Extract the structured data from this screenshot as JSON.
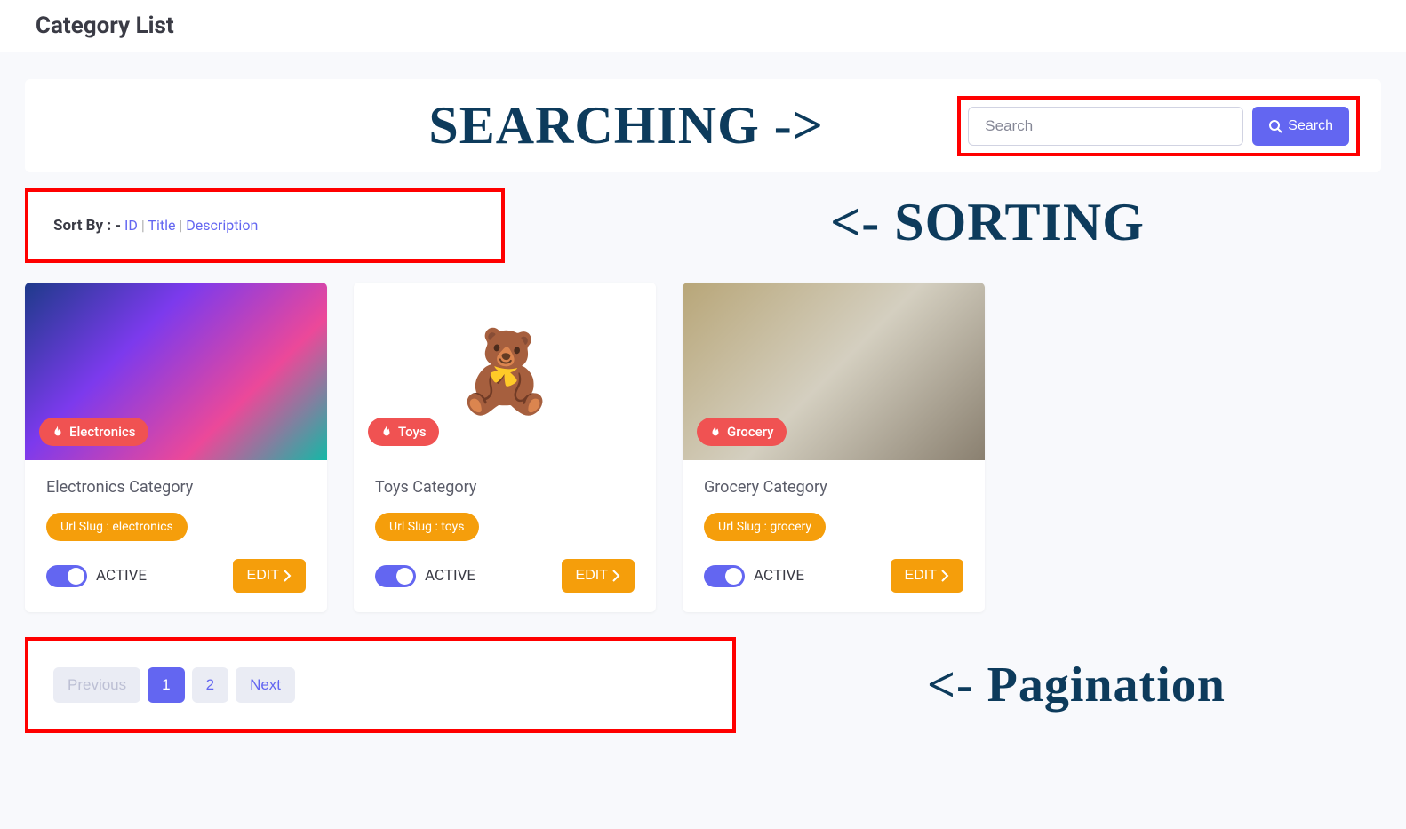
{
  "page": {
    "title": "Category List"
  },
  "annotations": {
    "searching": "SEARCHING ->",
    "sorting": "<- SORTING",
    "pagination": "<- Pagination"
  },
  "search": {
    "placeholder": "Search",
    "button_label": "Search"
  },
  "sort": {
    "label": "Sort By : -",
    "options": [
      "ID",
      "Title",
      "Description"
    ]
  },
  "cards": [
    {
      "badge": "Electronics",
      "title": "Electronics Category",
      "slug": "Url Slug : electronics",
      "status": "ACTIVE",
      "edit": "EDIT"
    },
    {
      "badge": "Toys",
      "title": "Toys Category",
      "slug": "Url Slug : toys",
      "status": "ACTIVE",
      "edit": "EDIT"
    },
    {
      "badge": "Grocery",
      "title": "Grocery Category",
      "slug": "Url Slug : grocery",
      "status": "ACTIVE",
      "edit": "EDIT"
    }
  ],
  "pagination": {
    "previous": "Previous",
    "pages": [
      "1",
      "2"
    ],
    "active_page": "1",
    "next": "Next"
  }
}
